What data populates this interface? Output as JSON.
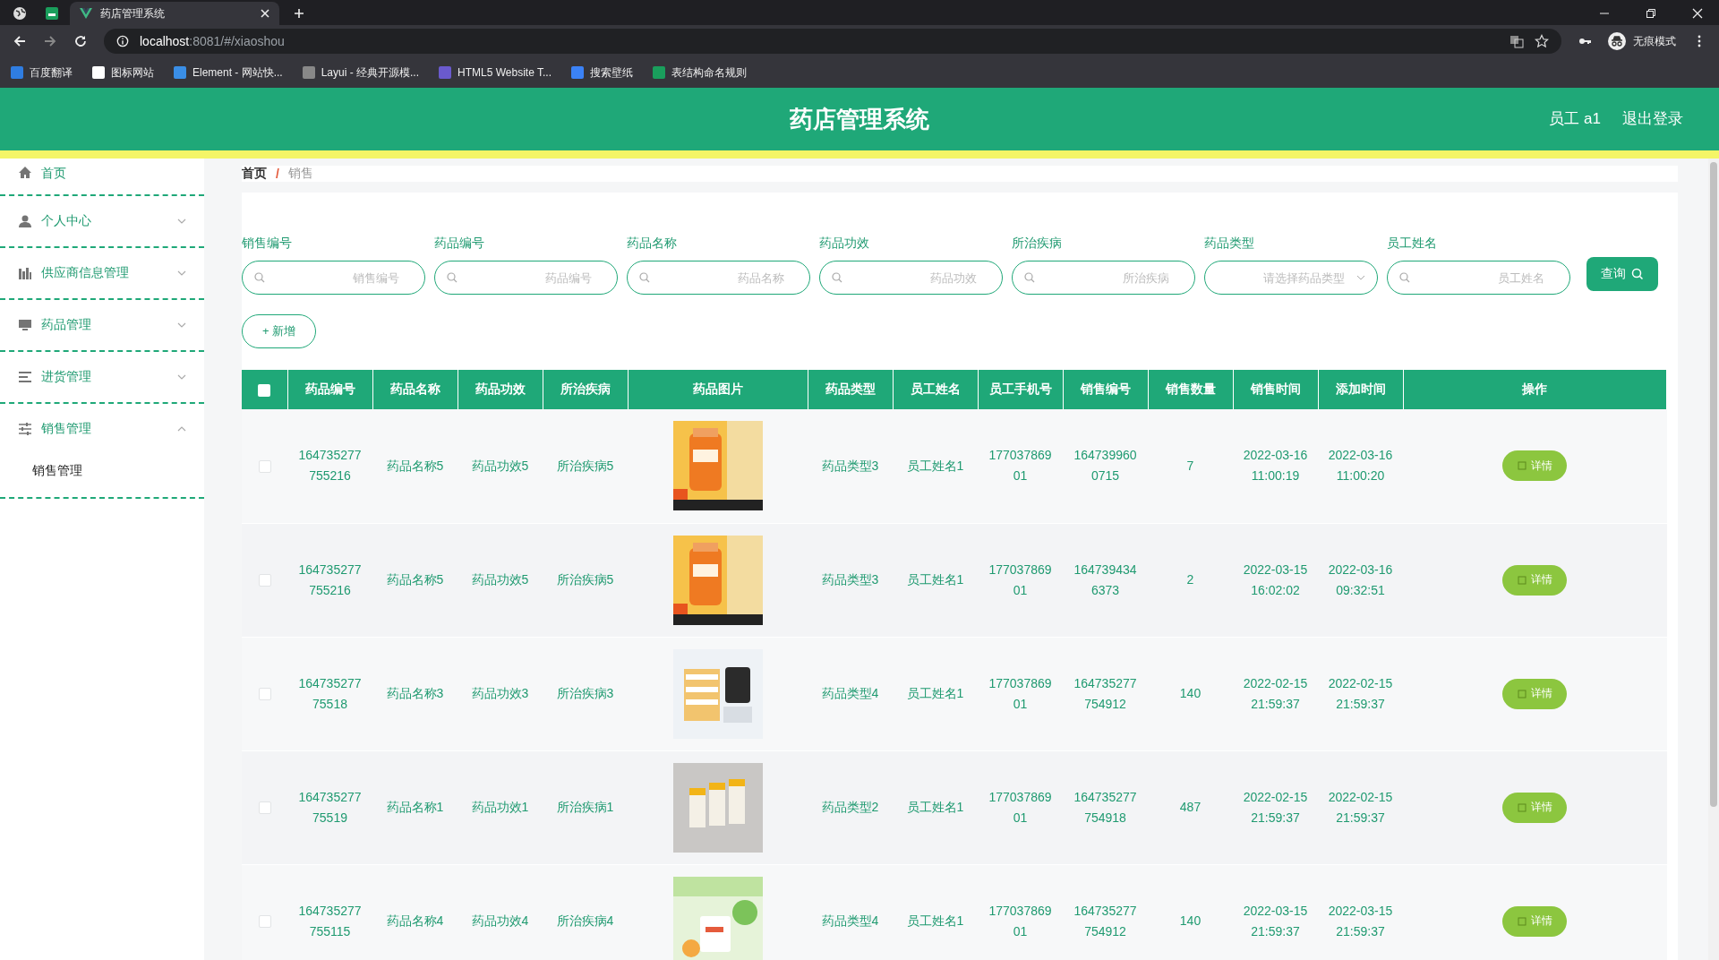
{
  "browser": {
    "tab_title": "药店管理系统",
    "url_host": "localhost",
    "url_rest": ":8081/#/xiaoshou",
    "profile": "无痕模式",
    "bookmarks": [
      "百度翻译",
      "图标网站",
      "Element - 网站快...",
      "Layui - 经典开源模...",
      "HTML5 Website T...",
      "搜索壁纸",
      "表结构命名规则"
    ]
  },
  "header": {
    "title": "药店管理系统",
    "user": "员工 a1",
    "logout": "退出登录"
  },
  "sidebar": [
    {
      "label": "首页"
    },
    {
      "label": "个人中心",
      "expanded": false
    },
    {
      "label": "供应商信息管理",
      "expanded": false
    },
    {
      "label": "药品管理",
      "expanded": false
    },
    {
      "label": "进货管理",
      "expanded": false
    },
    {
      "label": "销售管理",
      "expanded": true,
      "children": [
        {
          "label": "销售管理"
        }
      ]
    }
  ],
  "breadcrumb": [
    "首页",
    "销售"
  ],
  "breadcrumb_separator": "/",
  "filters": [
    {
      "label": "销售编号",
      "placeholder": "销售编号",
      "kind": "input"
    },
    {
      "label": "药品编号",
      "placeholder": "药品编号",
      "kind": "input"
    },
    {
      "label": "药品名称",
      "placeholder": "药品名称",
      "kind": "input"
    },
    {
      "label": "药品功效",
      "placeholder": "药品功效",
      "kind": "input"
    },
    {
      "label": "所治疾病",
      "placeholder": "所治疾病",
      "kind": "input"
    },
    {
      "label": "药品类型",
      "placeholder": "请选择药品类型",
      "kind": "select"
    },
    {
      "label": "员工姓名",
      "placeholder": "员工姓名",
      "kind": "input"
    }
  ],
  "query_button": "查询",
  "add_button": "新增",
  "add_button_icon": "+",
  "table": {
    "select_all_checked": false,
    "columns": [
      "药品编号",
      "药品名称",
      "药品功效",
      "所治疾病",
      "药品图片",
      "药品类型",
      "员工姓名",
      "员工手机号",
      "销售编号",
      "销售数量",
      "销售时间",
      "添加时间",
      "操作"
    ],
    "rows": [
      {
        "checked": false,
        "cells": [
          "164735277755216",
          "药品名称5",
          "药品功效5",
          "所治疾病5",
          "",
          "药品类型3",
          "员工姓名1",
          "17703786901",
          "1647399600715",
          "7",
          "2022-03-16 11:00:19",
          "2022-03-16 11:00:20"
        ],
        "action": "详情"
      },
      {
        "checked": false,
        "cells": [
          "164735277755216",
          "药品名称5",
          "药品功效5",
          "所治疾病5",
          "",
          "药品类型3",
          "员工姓名1",
          "17703786901",
          "1647394346373",
          "2",
          "2022-03-15 16:02:02",
          "2022-03-16 09:32:51"
        ],
        "action": "详情"
      },
      {
        "checked": false,
        "cells": [
          "16473527775518",
          "药品名称3",
          "药品功效3",
          "所治疾病3",
          "",
          "药品类型4",
          "员工姓名1",
          "17703786901",
          "164735277754912",
          "140",
          "2022-02-15 21:59:37",
          "2022-02-15 21:59:37"
        ],
        "action": "详情"
      },
      {
        "checked": false,
        "cells": [
          "16473527775519",
          "药品名称1",
          "药品功效1",
          "所治疾病1",
          "",
          "药品类型2",
          "员工姓名1",
          "17703786901",
          "164735277754918",
          "487",
          "2022-02-15 21:59:37",
          "2022-02-15 21:59:37"
        ],
        "action": "详情"
      },
      {
        "checked": false,
        "cells": [
          "164735277755115",
          "药品名称4",
          "药品功效4",
          "所治疾病4",
          "",
          "药品类型4",
          "员工姓名1",
          "17703786901",
          "164735277754912",
          "140",
          "2022-03-15 21:59:37",
          "2022-03-15 21:59:37"
        ],
        "action": "详情"
      }
    ]
  }
}
